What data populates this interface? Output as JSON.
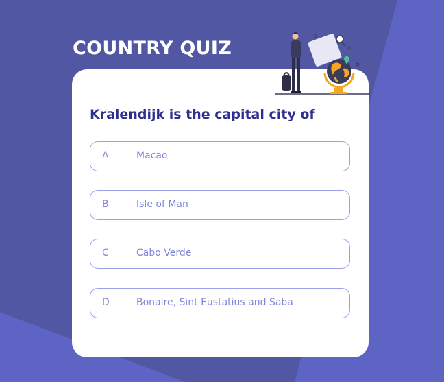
{
  "quiz": {
    "title": "COUNTRY QUIZ",
    "question": "Kralendijk is the capital city of",
    "options": [
      {
        "letter": "A",
        "text": "Macao"
      },
      {
        "letter": "B",
        "text": "Isle of Man"
      },
      {
        "letter": "C",
        "text": "Cabo Verde"
      },
      {
        "letter": "D",
        "text": "Bonaire, Sint Eustatius and Saba"
      }
    ]
  },
  "colors": {
    "background": "#5257a4",
    "accent_shape": "#5d64c4",
    "card": "#ffffff",
    "question_text": "#2f2f8f",
    "option_border": "#9a9fe6",
    "option_text": "#7f86d8",
    "globe_orange": "#f5a623"
  },
  "icons": {
    "illustration": "traveler-with-globe-illustration"
  }
}
